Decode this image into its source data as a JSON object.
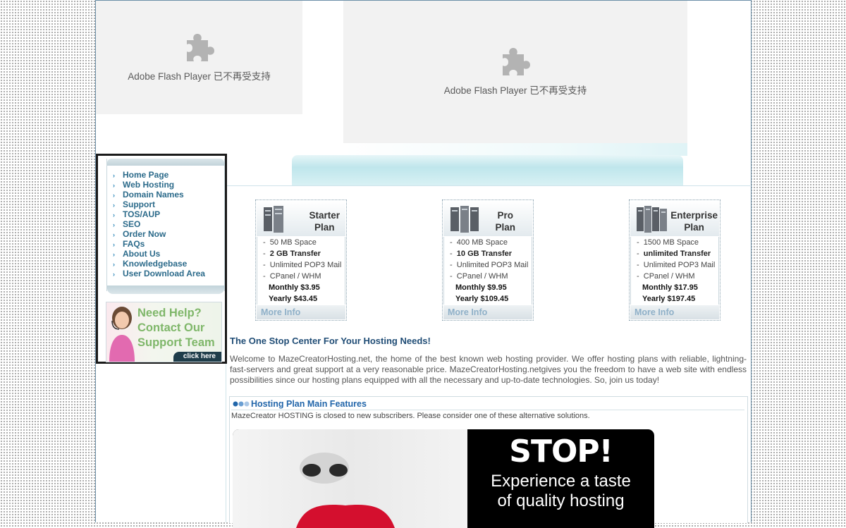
{
  "flash": {
    "left_message": "Adobe Flash Player 已不再受支持",
    "right_message": "Adobe Flash Player 已不再受支持"
  },
  "nav": {
    "items": [
      "Home Page",
      "Web Hosting",
      "Domain Names",
      "Support",
      "TOS/AUP",
      "SEO",
      "Order Now",
      "FAQs",
      "About Us",
      "Knowledgebase",
      "User Download Area"
    ]
  },
  "help": {
    "line1": "Need Help?",
    "line2": "Contact Our",
    "line3": "Support Team",
    "click": "click here"
  },
  "plans": [
    {
      "title1": "Starter",
      "title2": "Plan",
      "space": "50 MB Space",
      "transfer": "2 GB Transfer",
      "mail": "Unlimited POP3 Mail",
      "panel": "CPanel / WHM",
      "monthly": "Monthly $3.95",
      "yearly": "Yearly $43.45",
      "more": "More Info"
    },
    {
      "title1": "Pro",
      "title2": "Plan",
      "space": "400 MB Space",
      "transfer": "10 GB Transfer",
      "mail": "Unlimited POP3 Mail",
      "panel": "CPanel / WHM",
      "monthly": "Monthly $9.95",
      "yearly": "Yearly $109.45",
      "more": "More Info"
    },
    {
      "title1": "Enterprise",
      "title2": "Plan",
      "space": "1500 MB Space",
      "transfer": "unlimited Transfer",
      "mail": "Unlimited POP3 Mail",
      "panel": "CPanel / WHM",
      "monthly": "Monthly $17.95",
      "yearly": "Yearly $197.45",
      "more": "More Info"
    }
  ],
  "main": {
    "headline": "The One Stop Center For Your Hosting Needs!",
    "welcome": "Welcome to MazeCreatorHosting.net, the home of the best known web hosting provider. We offer hosting plans with reliable, lightning-fast-servers and great support at a very reasonable price. MazeCreatorHosting.netgives you the freedom to have a web site with endless possibilities since our hosting plans equipped with all the necessary and up-to-date technologies. So, join us today!"
  },
  "features": {
    "title": "Hosting Plan Main Features",
    "note": "MazeCreator HOSTING is closed to new subscribers. Please consider one of these alternative solutions."
  },
  "ad": {
    "stop": "STOP!",
    "line1": "Experience a taste",
    "line2": "of quality hosting"
  },
  "colors": {
    "link": "#2b6a8a",
    "headline": "#1f4c75",
    "feature_title": "#2266aa",
    "help_text": "#7fb76a"
  }
}
